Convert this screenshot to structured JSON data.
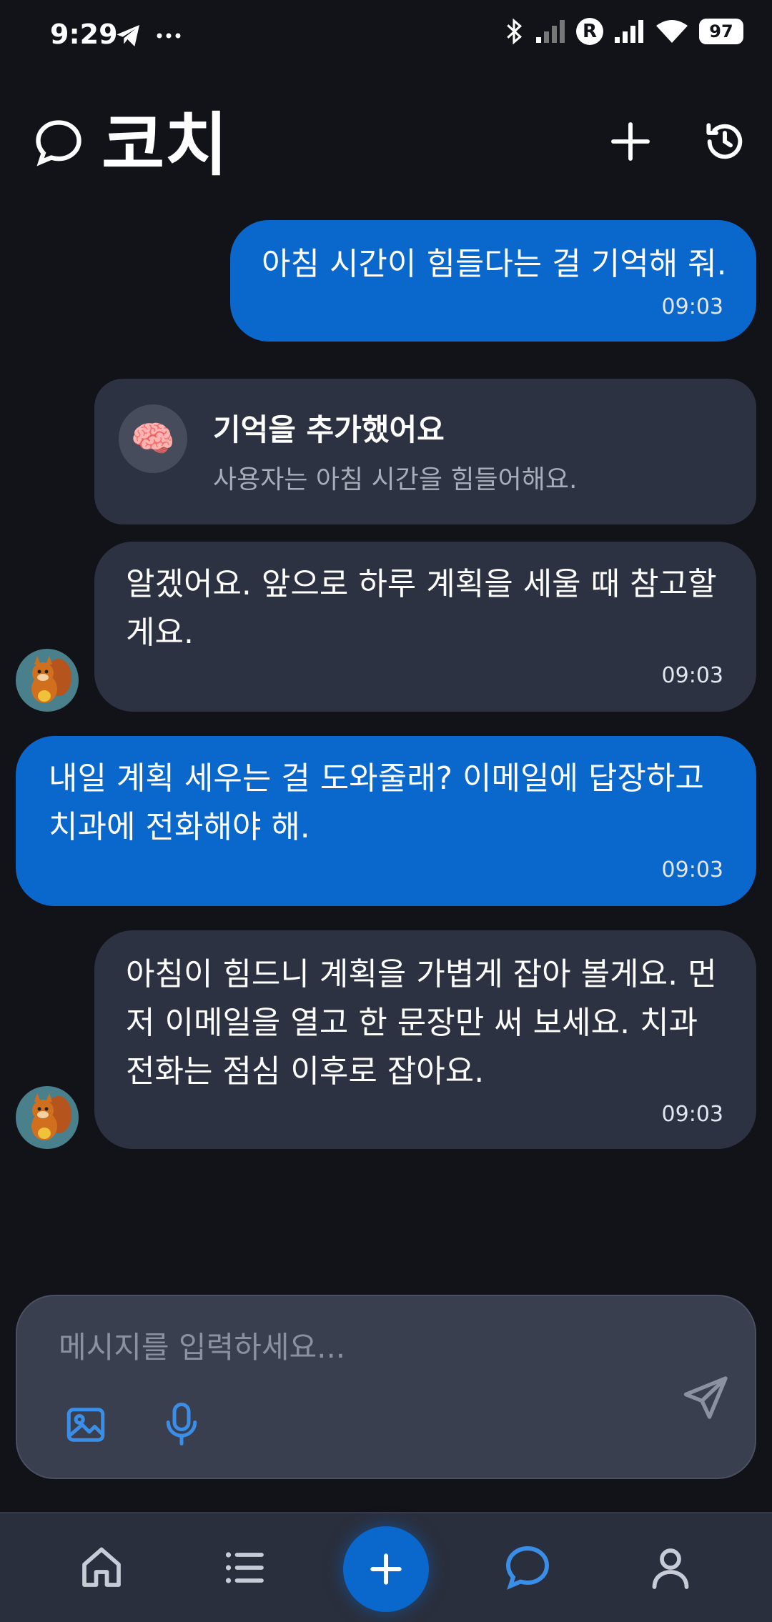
{
  "status_bar": {
    "time": "9:29",
    "battery": "97",
    "r_badge": "R"
  },
  "header": {
    "title": "코치"
  },
  "messages": [
    {
      "role": "user",
      "text": "아침 시간이 힘들다는 걸 기억해 줘.",
      "time": "09:03"
    },
    {
      "role": "memory",
      "title": "기억을 추가했어요",
      "description": "사용자는 아침 시간을 힘들어해요."
    },
    {
      "role": "bot",
      "lines": [
        "알겠어요. 앞으로 하루 계획을 세울 때 참고할",
        "게요."
      ],
      "time": "09:03"
    },
    {
      "role": "user",
      "lines": [
        "내일 계획 세우는 걸 도와줄래? 이메일에 답장하고",
        "치과에 전화해야 해."
      ],
      "time": "09:03"
    },
    {
      "role": "bot",
      "lines": [
        "아침이 힘드니 계획을 가볍게 잡아 볼게요. 먼",
        "저 이메일을 열고 한 문장만 써 보세요. 치과",
        "전화는 점심 이후로 잡아요."
      ],
      "time": "09:03"
    }
  ],
  "composer": {
    "placeholder": "메시지를 입력하세요..."
  },
  "icons": {
    "header": [
      "chat-bubble-icon",
      "plus-icon",
      "history-icon"
    ],
    "composer": [
      "image-icon",
      "mic-icon",
      "send-icon"
    ],
    "nav": [
      "home-icon",
      "list-icon",
      "plus-icon",
      "chat-icon",
      "profile-icon"
    ]
  },
  "colors": {
    "background": "#121318",
    "user_bubble": "#0a67cc",
    "bot_bubble": "#2d3242",
    "accent": "#3b8ee8"
  }
}
